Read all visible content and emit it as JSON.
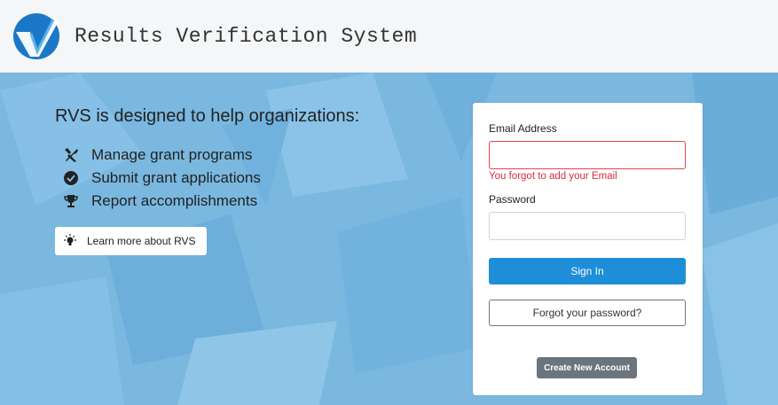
{
  "header": {
    "logo_icon": "checkmark-logo-icon",
    "title": "Results Verification System"
  },
  "hero": {
    "intro": "RVS is designed to help organizations:",
    "features": [
      {
        "icon": "tools-icon",
        "label": "Manage grant programs"
      },
      {
        "icon": "check-circle-icon",
        "label": "Submit grant applications"
      },
      {
        "icon": "trophy-icon",
        "label": "Report accomplishments"
      }
    ],
    "learn_more": {
      "icon": "lightbulb-icon",
      "label": "Learn more about RVS"
    }
  },
  "login": {
    "email_label": "Email Address",
    "email_value": "",
    "email_error": "You forgot to add your Email",
    "password_label": "Password",
    "password_value": "",
    "sign_in": "Sign In",
    "forgot": "Forgot your password?",
    "create_account": "Create New Account"
  },
  "colors": {
    "background_blue": "#7ab8e0",
    "primary_button": "#1e8ed8",
    "secondary_button": "#6c757d",
    "error": "#d33040"
  }
}
